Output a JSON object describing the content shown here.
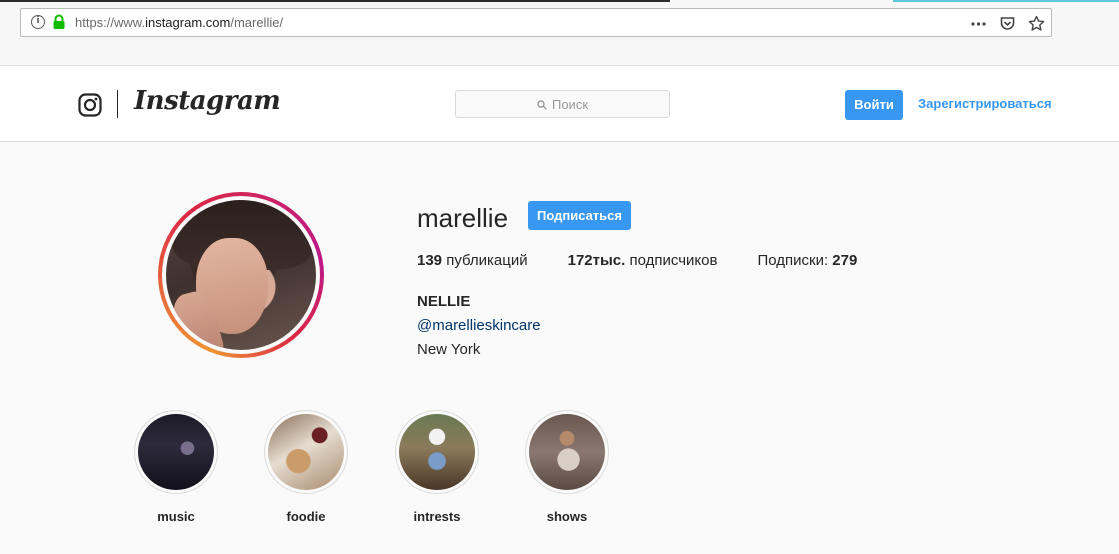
{
  "browser": {
    "url_prefix": "https://www.",
    "url_domain": "instagram.com",
    "url_path": "/marellie/",
    "icons": [
      "info-icon",
      "lock-icon",
      "page-actions-icon",
      "pocket-icon",
      "bookmark-star-icon"
    ]
  },
  "header": {
    "wordmark": "Instagram",
    "search_placeholder": "Поиск",
    "login_label": "Войти",
    "signup_label": "Зарегистрироваться",
    "icons": [
      "instagram-glyph-icon",
      "search-icon"
    ],
    "accent_color": "#3897f0"
  },
  "profile": {
    "username": "marellie",
    "follow_label": "Подписаться",
    "stats": {
      "posts_count": "139",
      "posts_label": " публикаций",
      "followers_count": "172тыс.",
      "followers_label": " подписчиков",
      "following_label": "Подписки: ",
      "following_count": "279"
    },
    "bio": {
      "name": "NELLIE",
      "link": "@marellieskincare",
      "location": "New York"
    }
  },
  "highlights": [
    {
      "label": "music"
    },
    {
      "label": "foodie"
    },
    {
      "label": "intrests"
    },
    {
      "label": "shows"
    }
  ]
}
